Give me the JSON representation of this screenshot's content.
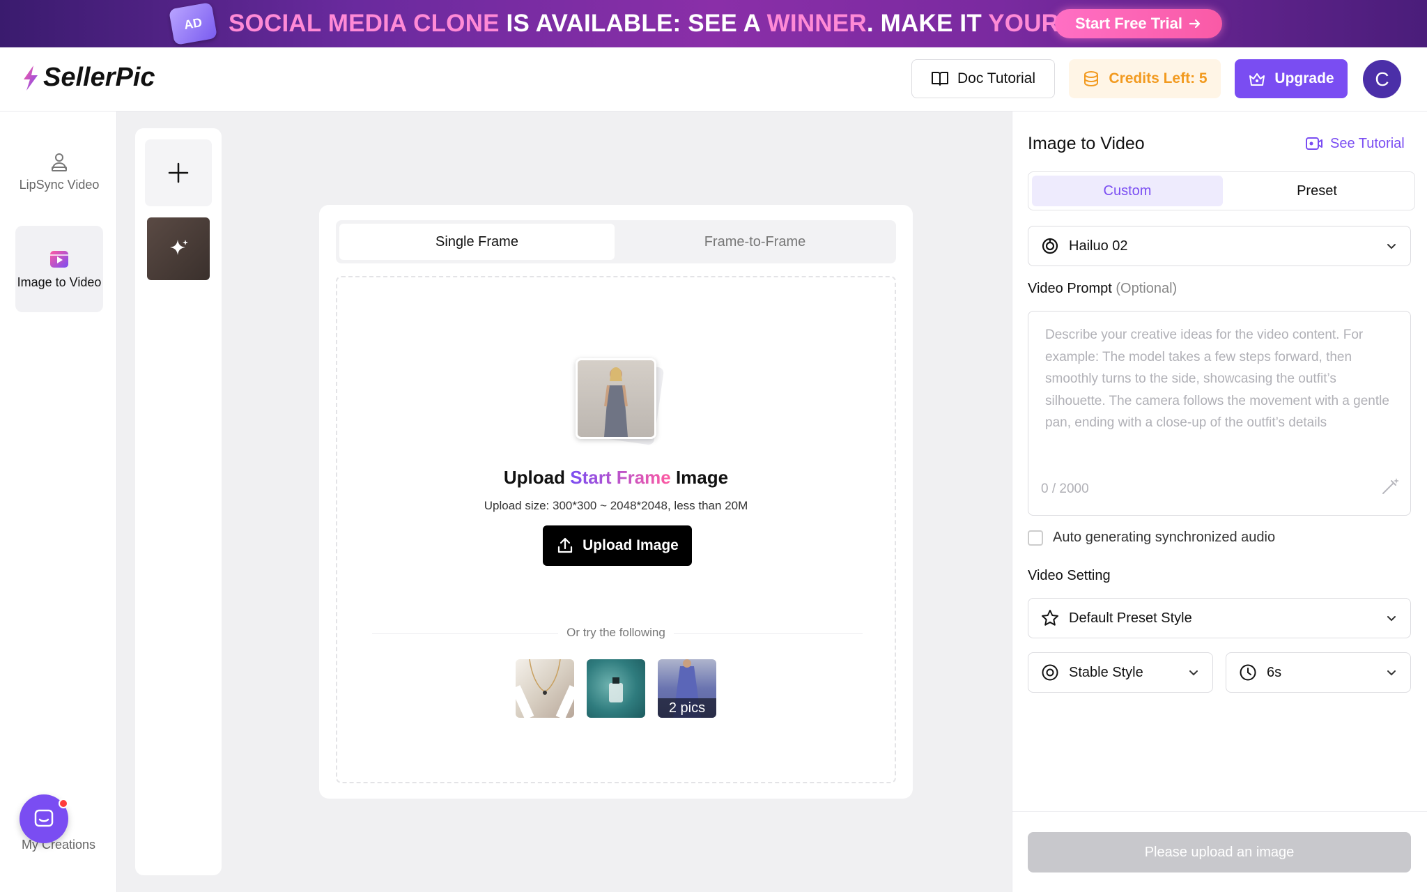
{
  "banner": {
    "badge": "AD",
    "text_1": "SOCIAL MEDIA CLONE",
    "text_2": " IS AVAILABLE: SEE A ",
    "text_3": "WINNER",
    "text_4": ". MAKE IT ",
    "text_5": "YOURS",
    "text_6": ".",
    "cta_label": "Start Free Trial",
    "cta_icon": "arrow-right-icon"
  },
  "header": {
    "logo_text": "SellerPic",
    "doc_tutorial_label": "Doc Tutorial",
    "credits_label": "Credits Left: 5",
    "upgrade_label": "Upgrade",
    "avatar_initial": "C"
  },
  "leftnav": {
    "items": [
      {
        "label": "LipSync Video",
        "icon": "lipsync-icon",
        "active": false
      },
      {
        "label": "Image to Video",
        "icon": "image-to-video-icon",
        "active": true
      }
    ],
    "my_creations_label": "My Creations"
  },
  "main": {
    "tabs": [
      {
        "label": "Single Frame",
        "active": true
      },
      {
        "label": "Frame-to-Frame",
        "active": false
      }
    ],
    "upload_title_1": "Upload ",
    "upload_title_2": "Start Frame",
    "upload_title_3": " Image",
    "upload_size": "Upload size: 300*300 ~ 2048*2048, less than 20M",
    "upload_button": "Upload Image",
    "try_text": "Or try the following",
    "samples_badge": "2 pics"
  },
  "panel": {
    "title": "Image to Video",
    "see_tutorial": "See Tutorial",
    "segments": [
      {
        "label": "Custom",
        "active": true
      },
      {
        "label": "Preset",
        "active": false
      }
    ],
    "model": "Hailuo 02",
    "prompt_label": "Video Prompt",
    "prompt_optional": "(Optional)",
    "prompt_placeholder": "Describe your creative ideas for the video content. For example: The model takes a few steps forward, then smoothly turns to the side, showcasing the outfit’s silhouette. The camera follows the movement with a gentle pan, ending with a close-up of the outfit’s details",
    "prompt_count": "0 / 2000",
    "audio_label": "Auto generating synchronized audio",
    "audio_checked": false,
    "video_setting_label": "Video Setting",
    "preset_style": "Default Preset Style",
    "stable_style": "Stable Style",
    "duration": "6s",
    "generate_label": "Please upload an image"
  },
  "colors": {
    "accent": "#7a4df2",
    "credits": "#f29a1f",
    "banner_pink": "#ff6fc4"
  }
}
